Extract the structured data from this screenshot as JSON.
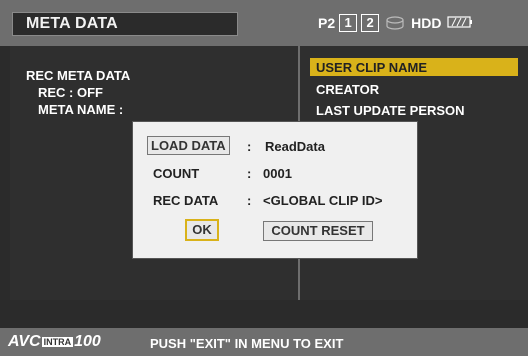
{
  "header": {
    "title": "META DATA",
    "p2_label": "P2",
    "slot1": "1",
    "slot2": "2",
    "hdd_label": "HDD"
  },
  "left": {
    "rec_meta_data": "REC META DATA",
    "rec_off": "REC : OFF",
    "meta_name": "META NAME :"
  },
  "menu": {
    "items": [
      "USER CLIP NAME",
      "CREATOR",
      "LAST UPDATE PERSON"
    ],
    "selected_index": 0
  },
  "dialog": {
    "load_data_label": "LOAD DATA",
    "load_data_sep": ":",
    "load_data_value": "ReadData",
    "count_label": "COUNT",
    "count_sep": ":",
    "count_value": "0001",
    "rec_data_label": "REC DATA",
    "rec_data_sep": ":",
    "rec_data_value": "<GLOBAL CLIP ID>",
    "ok_label": "OK",
    "count_reset_label": "COUNT RESET"
  },
  "footer": {
    "logo_avc": "AVC",
    "logo_intra": "INTRA",
    "logo_num": "100",
    "message": "PUSH \"EXIT\" IN MENU TO EXIT"
  },
  "colors": {
    "accent": "#d9b21a",
    "bar": "#6e6e6e",
    "panel": "#2f2f2f"
  }
}
